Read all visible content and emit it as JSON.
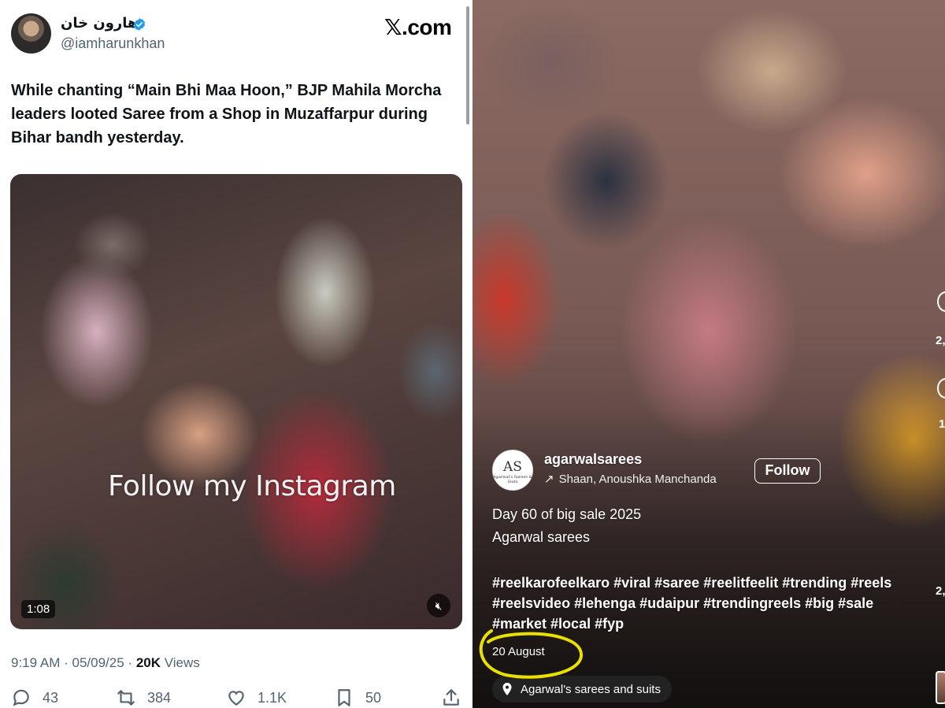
{
  "tweet": {
    "display_name": "هارون خان",
    "handle": "@iamharunkhan",
    "platform_logo": "𝕏.com",
    "text": "While chanting “Main Bhi Maa Hoon,” BJP Mahila Morcha leaders looted Saree from a Shop in Muzaffarpur during Bihar bandh yesterday.",
    "video": {
      "overlay_text": "Follow my Instagram",
      "duration": "1:08",
      "mute_icon": "speaker-muted-icon"
    },
    "meta": {
      "time": "9:19 AM",
      "date": "05/09/25",
      "views_count": "20K",
      "views_label": "Views"
    },
    "actions": {
      "replies": "43",
      "reposts": "384",
      "likes": "1.1K",
      "bookmarks": "50"
    },
    "colors": {
      "text": "#0f1419",
      "secondary": "#536471",
      "verified": "#1d9bf0"
    }
  },
  "reel": {
    "account": {
      "username": "agarwalsarees",
      "avatar_monogram": "AS",
      "avatar_subtext": "Agarwal's Sarees & Suits",
      "audio": "Shaan, Anoushka Manchanda"
    },
    "follow_label": "Follow",
    "caption": {
      "line1": "Day 60 of big sale 2025",
      "line2": "Agarwal sarees",
      "hashtags": "#reelkarofeelkaro #viral #saree #reelitfeelit #trending #reels #reelsvideo #lehenga #udaipur #trendingreels #big #sale #market #local #fyp"
    },
    "date": "20 August",
    "location": "Agarwal's sarees and suits",
    "side_counts": [
      "2,",
      "1",
      "2,"
    ],
    "colors": {
      "highlight": "#e8e000"
    }
  }
}
